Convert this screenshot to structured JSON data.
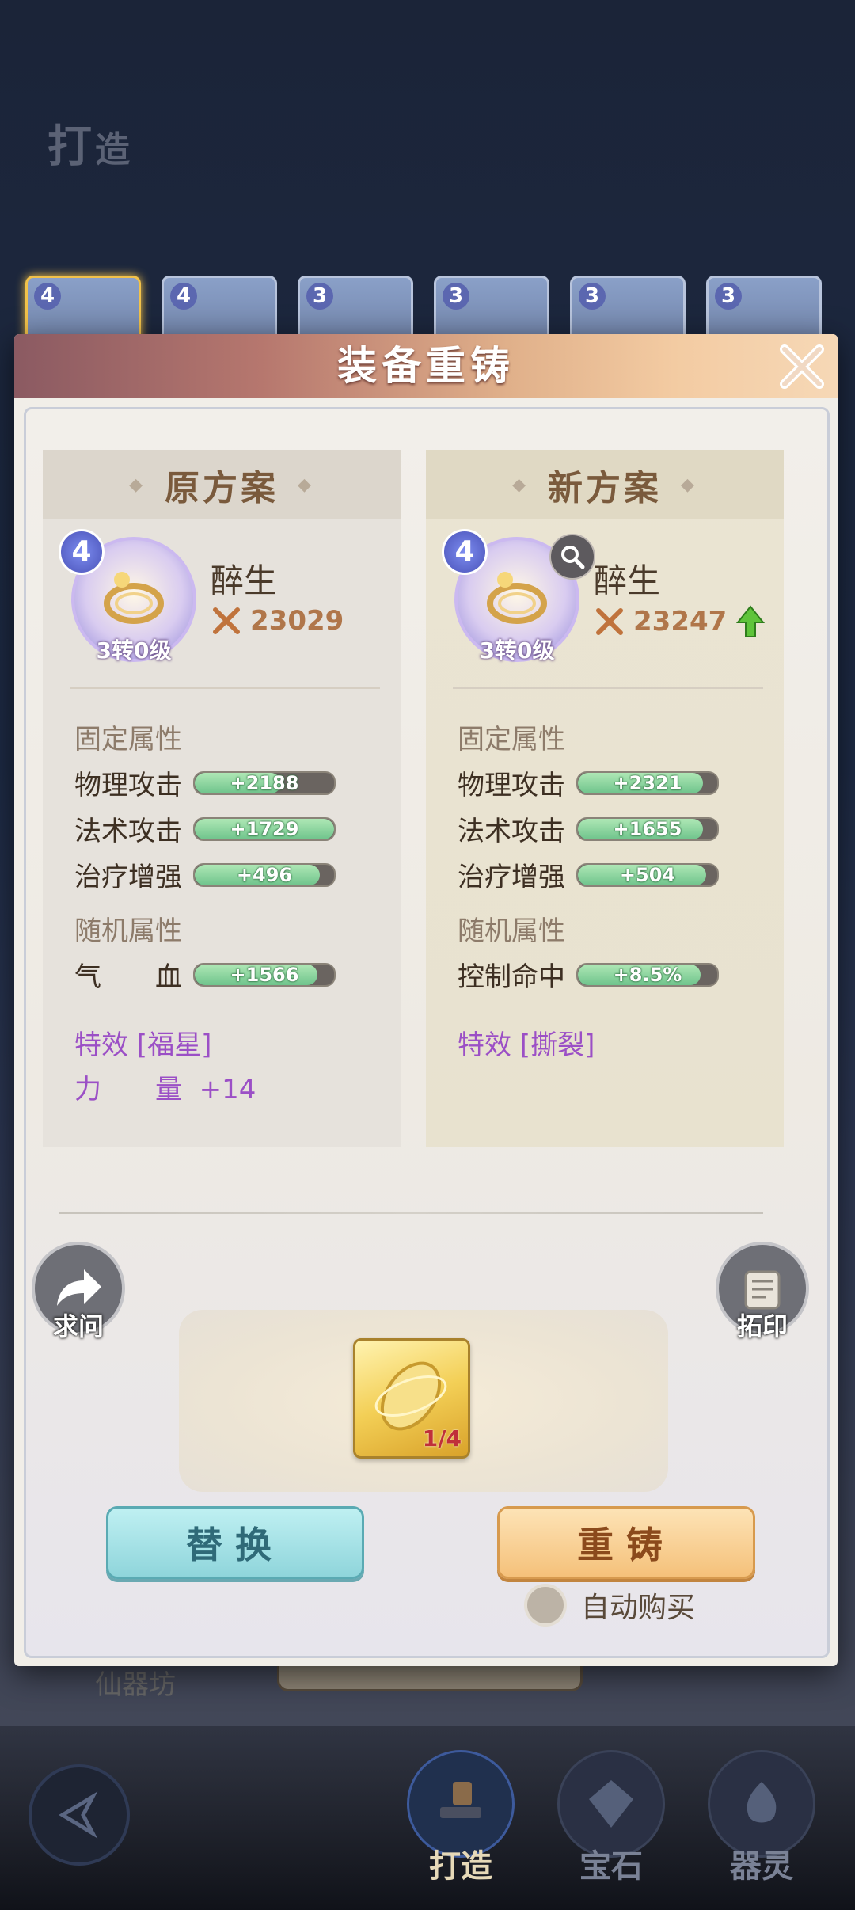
{
  "background": {
    "title_main": "打",
    "title_small": "造",
    "slots": [
      {
        "level": "4"
      },
      {
        "level": "4"
      },
      {
        "level": "3"
      },
      {
        "level": "3"
      },
      {
        "level": "3"
      },
      {
        "level": "3"
      }
    ],
    "bottom_label": "仙器坊"
  },
  "dock": {
    "items": [
      {
        "label": "打造",
        "icon": "anvil-icon"
      },
      {
        "label": "宝石",
        "icon": "gem-icon"
      },
      {
        "label": "器灵",
        "icon": "spirit-icon"
      }
    ]
  },
  "modal": {
    "title": "装备重铸",
    "left": {
      "header": "原方案",
      "item_level": "4",
      "item_rank": "3转0级",
      "item_name": "醉生",
      "power": "23029",
      "fixed_label": "固定属性",
      "fixed_attrs": [
        {
          "name": "物理攻击",
          "value": "+2188",
          "fill": 0.62
        },
        {
          "name": "法术攻击",
          "value": "+1729",
          "fill": 1.0
        },
        {
          "name": "治疗增强",
          "value": "+496",
          "fill": 0.9
        }
      ],
      "random_label": "随机属性",
      "random_attrs": [
        {
          "name": "气　　血",
          "value": "+1566",
          "fill": 0.88
        }
      ],
      "effect": "特效 [福星]",
      "bonus_name": "力　　量",
      "bonus_value": "+14"
    },
    "right": {
      "header": "新方案",
      "item_level": "4",
      "item_rank": "3转0级",
      "item_name": "醉生",
      "power": "23247",
      "fixed_label": "固定属性",
      "fixed_attrs": [
        {
          "name": "物理攻击",
          "value": "+2321",
          "fill": 0.9
        },
        {
          "name": "法术攻击",
          "value": "+1655",
          "fill": 0.9
        },
        {
          "name": "治疗增强",
          "value": "+504",
          "fill": 0.92
        }
      ],
      "random_label": "随机属性",
      "random_attrs": [
        {
          "name": "控制命中",
          "value": "+8.5%",
          "fill": 0.88
        }
      ],
      "effect": "特效 [撕裂]"
    },
    "ask_label": "求问",
    "imprint_label": "拓印",
    "material_count": "1/4",
    "replace_label": "替换",
    "recast_label": "重铸",
    "autobuy_label": "自动购买"
  },
  "colors": {
    "purple_effect": "#9b4fc6",
    "bar_fill": "#6fc48c",
    "power": "#b0764a"
  }
}
